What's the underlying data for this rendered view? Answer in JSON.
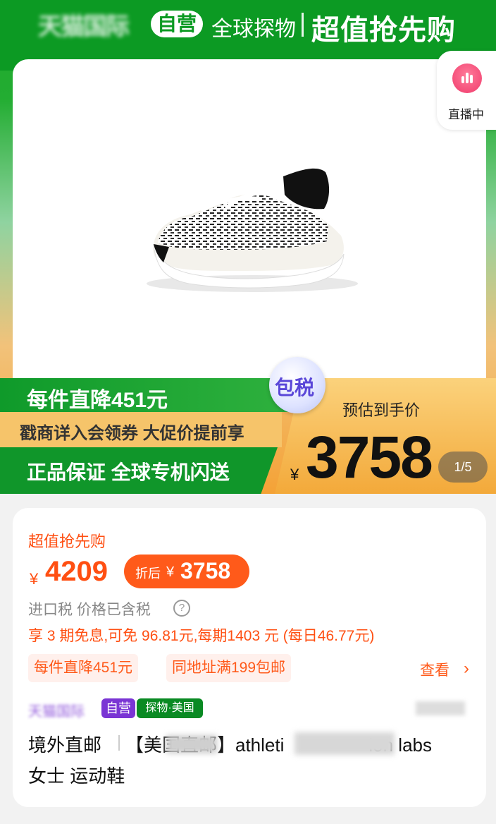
{
  "banner": {
    "store": "天猫国际",
    "ziying": "自营",
    "tagline": "全球探物",
    "headline": "超值抢先购"
  },
  "live": {
    "label": "直播中",
    "icon": "live-chart-icon"
  },
  "promo": {
    "line1": "每件直降451元",
    "line2": "戳商详入会领券  大促价提前享",
    "line3": "正品保证 全球专机闪送",
    "badge": "包税",
    "est_label": "预估到手价",
    "currency": "¥",
    "est_price": "3758"
  },
  "gallery": {
    "pager": "1/5"
  },
  "price_card": {
    "title": "超值抢先购",
    "currency": "¥",
    "price": "4209",
    "after_label": "折后",
    "after_currency": "¥",
    "after_price": "3758",
    "tax_note": "进口税 价格已含税",
    "help_icon": "?",
    "installment": "享 3 期免息,可免 96.81元,每期1403 元 (每日46.77元)",
    "tags": [
      "每件直降451元",
      "同地址满199包邮"
    ],
    "more": "查看",
    "more_icon": "›"
  },
  "product": {
    "store_badge": "天猫国际",
    "ziying_badge": "自营",
    "origin_badge": "探物·美国",
    "shipping": "境外直邮",
    "title_part1": "【美国直邮】athleti",
    "title_part2": "ion labs",
    "title_line2": "女士 运动鞋"
  },
  "colors": {
    "brand_green": "#0c9a23",
    "accent_orange": "#ff4f12",
    "badge_purple": "#7a35d4"
  }
}
